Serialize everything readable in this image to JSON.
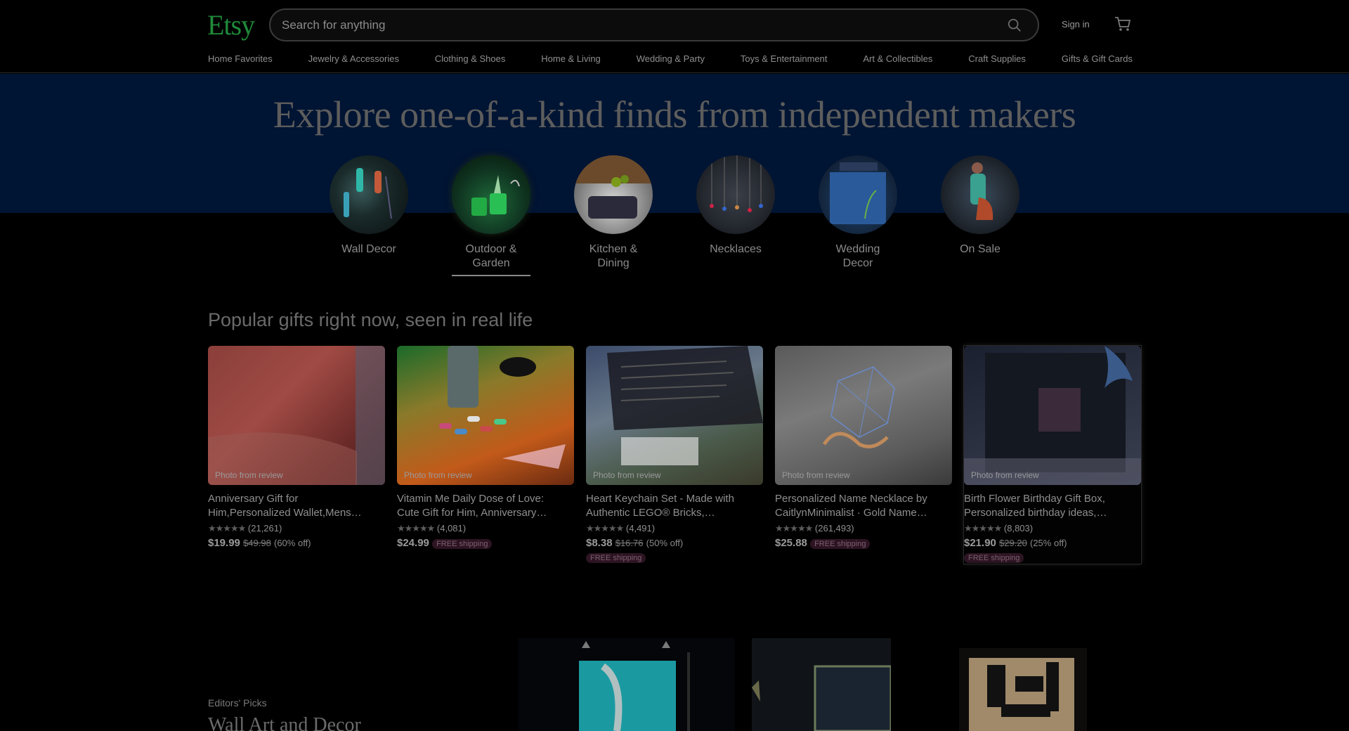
{
  "brand": {
    "logo": "Etsy",
    "accent": "#1f8a3a"
  },
  "search": {
    "placeholder": "Search for anything",
    "icon": "search-icon"
  },
  "header": {
    "signin": "Sign in",
    "cart_icon": "cart-icon"
  },
  "nav": {
    "categories": [
      "Home Favorites",
      "Jewelry & Accessories",
      "Clothing & Shoes",
      "Home & Living",
      "Wedding & Party",
      "Toys & Entertainment",
      "Art & Collectibles",
      "Craft Supplies",
      "Gifts & Gift Cards"
    ]
  },
  "hero": {
    "title": "Explore one-of-a-kind finds from independent makers",
    "circles": [
      {
        "line1": "Wall Decor",
        "line2": "",
        "active": false
      },
      {
        "line1": "Outdoor &",
        "line2": "Garden",
        "active": true
      },
      {
        "line1": "Kitchen &",
        "line2": "Dining",
        "active": false
      },
      {
        "line1": "Necklaces",
        "line2": "",
        "active": false
      },
      {
        "line1": "Wedding",
        "line2": "Decor",
        "active": false
      },
      {
        "line1": "On Sale",
        "line2": "",
        "active": false
      }
    ]
  },
  "popular": {
    "title": "Popular gifts right now, seen in real life",
    "photo_tag": "Photo from review",
    "items": [
      {
        "title1": "Anniversary Gift for",
        "title2": "Him,Personalized Wallet,Mens…",
        "stars": "★★★★★",
        "reviews": "(21,261)",
        "price": "$19.99",
        "old_price": "$49.98",
        "discount": "(60% off)",
        "free_shipping": ""
      },
      {
        "title1": "Vitamin Me Daily Dose of Love:",
        "title2": "Cute Gift for Him, Anniversary…",
        "stars": "★★★★★",
        "reviews": "(4,081)",
        "price": "$24.99",
        "old_price": "",
        "discount": "",
        "free_shipping": "FREE shipping"
      },
      {
        "title1": "Heart Keychain Set - Made with",
        "title2": "Authentic LEGO® Bricks,…",
        "stars": "★★★★★",
        "reviews": "(4,491)",
        "price": "$8.38",
        "old_price": "$16.76",
        "discount": "(50% off)",
        "free_shipping": "FREE shipping"
      },
      {
        "title1": "Personalized Name Necklace by",
        "title2": "CaitlynMinimalist · Gold Name…",
        "stars": "★★★★★",
        "reviews": "(261,493)",
        "price": "$25.88",
        "old_price": "",
        "discount": "",
        "free_shipping": "FREE shipping"
      },
      {
        "title1": "Birth Flower Birthday Gift Box,",
        "title2": "Personalized birthday ideas,…",
        "stars": "★★★★★",
        "reviews": "(8,803)",
        "price": "$21.90",
        "old_price": "$29.20",
        "discount": "(25% off)",
        "free_shipping": "FREE shipping"
      }
    ]
  },
  "editors": {
    "label": "Editors' Picks",
    "title": "Wall Art and Decor"
  }
}
